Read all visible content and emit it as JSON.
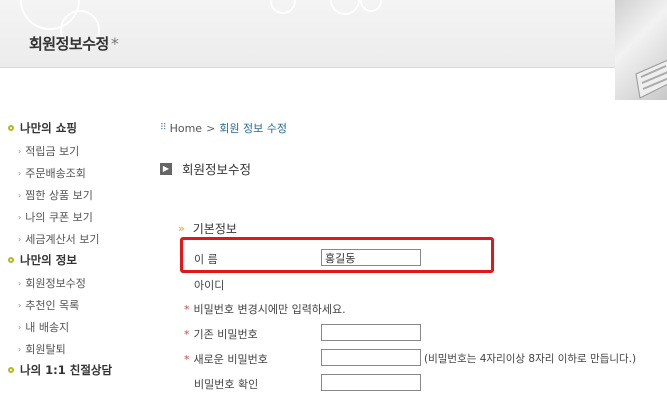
{
  "header": {
    "title": "회원정보수정",
    "title_mark": "*"
  },
  "nav": {
    "groups": [
      {
        "label": "나만의 쇼핑",
        "items": [
          "적립금 보기",
          "주문배송조회",
          "찜한 상품 보기",
          "나의 쿠폰 보기",
          "세금계산서 보기"
        ]
      },
      {
        "label": "나만의 정보",
        "items": [
          "회원정보수정",
          "추천인 목록",
          "내 배송지",
          "회원탈퇴"
        ]
      },
      {
        "label": "나의 1:1 친절상담",
        "items": []
      }
    ]
  },
  "breadcrumb": {
    "home": "Home",
    "current": "회원 정보 수정"
  },
  "page_title": "회원정보수정",
  "form": {
    "section_title": "기본정보",
    "name_label": "이 름",
    "name_value": "홍길동",
    "id_label": "아이디",
    "password_note": "비밀번호 변경시에만 입력하세요.",
    "current_password_label": "기존 비밀번호",
    "new_password_label": "새로운 비밀번호",
    "new_password_hint": "(비밀번호는 4자리이상 8자리 이하로 만듭니다.)",
    "confirm_password_label": "비밀번호 확인",
    "required_mark": "*"
  },
  "icons": {
    "breadcrumb": "grid-icon",
    "title": "square-arrow-icon",
    "section": "double-chevron-icon",
    "nav": "bullet-circle-icon",
    "keyboard": "keyboard-icon"
  },
  "colors": {
    "highlight_border": "#e01818",
    "bullet": "#b5b820",
    "section_marker": "#e0a020",
    "breadcrumb_current": "#2a6a9a"
  }
}
